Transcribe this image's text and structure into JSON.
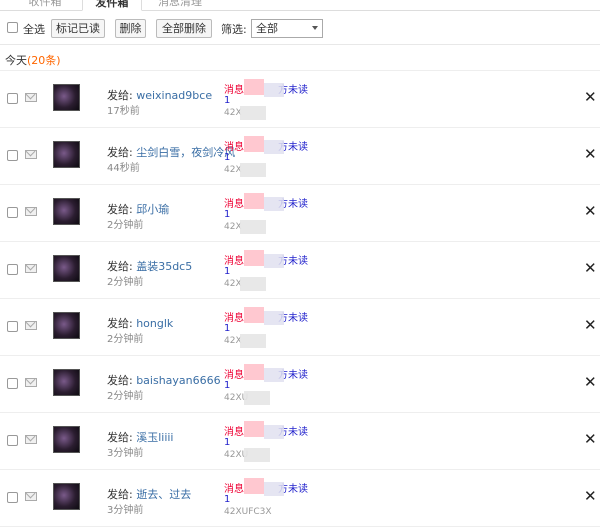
{
  "tabs": [
    "收件箱",
    "发件箱",
    "消息清理"
  ],
  "toolbar": {
    "select_all": "全选",
    "mark_read": "标记已读",
    "delete": "删除",
    "delete_all": "全部删除",
    "filter_label": "筛选:",
    "filter_value": "全部"
  },
  "section": {
    "title": "今天",
    "count": "(20条)"
  },
  "to_prefix": "发给: ",
  "rows": [
    {
      "name": "weixinad9bce",
      "time": "17秒前",
      "msg_a": "消息",
      "msg_b": "方未读",
      "msg_line2": "1",
      "code": "42X"
    },
    {
      "name": "尘剑白雪，夜剑冷风",
      "time": "44秒前",
      "msg_a": "消息",
      "msg_b": "方未读",
      "msg_line2": "1",
      "code": "42X"
    },
    {
      "name": "邱小瑜",
      "time": "2分钟前",
      "msg_a": "消息",
      "msg_b": "方未读",
      "msg_line2": "1",
      "code": "42X"
    },
    {
      "name": "盖装35dc5",
      "time": "2分钟前",
      "msg_a": "消息",
      "msg_b": "方未读",
      "msg_line2": "1",
      "code": "42X"
    },
    {
      "name": "honglk",
      "time": "2分钟前",
      "msg_a": "消息",
      "msg_b": "方未读",
      "msg_line2": "1",
      "code": "42X"
    },
    {
      "name": "baishayan6666",
      "time": "2分钟前",
      "msg_a": "消息",
      "msg_b": "方未读",
      "msg_line2": "1",
      "code": "42XU"
    },
    {
      "name": "溪玉liiii",
      "time": "3分钟前",
      "msg_a": "消息",
      "msg_b": "方未读",
      "msg_line2": "1",
      "code": "42XU"
    },
    {
      "name": "逝去、过去",
      "time": "3分钟前",
      "msg_a": "消息",
      "msg_b": "方未读",
      "msg_line2": "1",
      "code": "42XUFC3X"
    }
  ],
  "delete_glyph": "✕"
}
